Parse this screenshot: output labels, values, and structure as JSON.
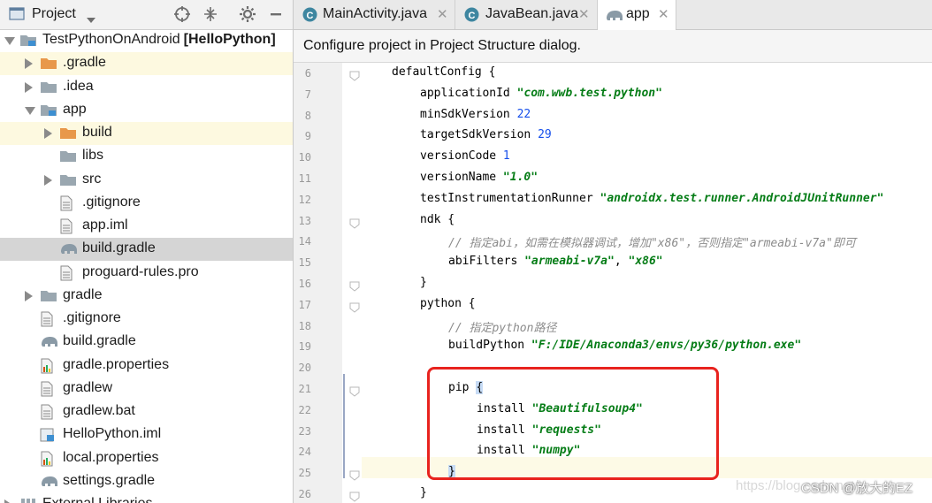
{
  "project_panel": {
    "title": "Project",
    "tree": [
      {
        "label": "TestPythonOnAndroid",
        "suffix": "[HelloPython]",
        "icon": "module-folder-icon",
        "arrow": "down",
        "depth": 0
      },
      {
        "label": ".gradle",
        "icon": "orange-folder-icon",
        "arrow": "right",
        "depth": 1,
        "highlight": true
      },
      {
        "label": ".idea",
        "icon": "folder-icon",
        "arrow": "right",
        "depth": 1
      },
      {
        "label": "app",
        "icon": "module-folder-icon",
        "arrow": "down",
        "depth": 1
      },
      {
        "label": "build",
        "icon": "orange-folder-icon",
        "arrow": "right",
        "depth": 2,
        "highlight": true
      },
      {
        "label": "libs",
        "icon": "folder-icon",
        "arrow": "none",
        "depth": 2
      },
      {
        "label": "src",
        "icon": "folder-icon",
        "arrow": "right",
        "depth": 2
      },
      {
        "label": ".gitignore",
        "icon": "text-file-icon",
        "arrow": "none",
        "depth": 2
      },
      {
        "label": "app.iml",
        "icon": "text-file-icon",
        "arrow": "none",
        "depth": 2
      },
      {
        "label": "build.gradle",
        "icon": "gradle-elephant-icon",
        "arrow": "none",
        "depth": 2,
        "selected": true
      },
      {
        "label": "proguard-rules.pro",
        "icon": "text-file-icon",
        "arrow": "none",
        "depth": 2
      },
      {
        "label": "gradle",
        "icon": "folder-icon",
        "arrow": "right",
        "depth": 1
      },
      {
        "label": ".gitignore",
        "icon": "text-file-icon",
        "arrow": "none",
        "depth": 1
      },
      {
        "label": "build.gradle",
        "icon": "gradle-elephant-icon",
        "arrow": "none",
        "depth": 1
      },
      {
        "label": "gradle.properties",
        "icon": "properties-file-icon",
        "arrow": "none",
        "depth": 1
      },
      {
        "label": "gradlew",
        "icon": "text-file-icon",
        "arrow": "none",
        "depth": 1
      },
      {
        "label": "gradlew.bat",
        "icon": "text-file-icon",
        "arrow": "none",
        "depth": 1
      },
      {
        "label": "HelloPython.iml",
        "icon": "module-file-icon",
        "arrow": "none",
        "depth": 1
      },
      {
        "label": "local.properties",
        "icon": "properties-file-icon",
        "arrow": "none",
        "depth": 1
      },
      {
        "label": "settings.gradle",
        "icon": "gradle-elephant-icon",
        "arrow": "none",
        "depth": 1
      },
      {
        "label": "External Libraries",
        "icon": "library-icon",
        "arrow": "right",
        "depth": 0
      }
    ]
  },
  "tabs": [
    {
      "label": "MainActivity.java",
      "icon": "java-class-icon",
      "active": false
    },
    {
      "label": "JavaBean.java",
      "icon": "java-class-icon",
      "active": false
    },
    {
      "label": "app",
      "icon": "gradle-elephant-icon",
      "active": true
    }
  ],
  "notice": "Configure project in Project Structure dialog.",
  "editor": {
    "lines": [
      {
        "n": "6",
        "indent": 1,
        "parts": [
          [
            "t",
            "defaultConfig {"
          ]
        ]
      },
      {
        "n": "7",
        "indent": 2,
        "parts": [
          [
            "t",
            "applicationId "
          ],
          [
            "s",
            "\"com.wwb.test.python\""
          ]
        ]
      },
      {
        "n": "8",
        "indent": 2,
        "parts": [
          [
            "t",
            "minSdkVersion "
          ],
          [
            "n",
            "22"
          ]
        ]
      },
      {
        "n": "9",
        "indent": 2,
        "parts": [
          [
            "t",
            "targetSdkVersion "
          ],
          [
            "n",
            "29"
          ]
        ]
      },
      {
        "n": "10",
        "indent": 2,
        "parts": [
          [
            "t",
            "versionCode "
          ],
          [
            "n",
            "1"
          ]
        ]
      },
      {
        "n": "11",
        "indent": 2,
        "parts": [
          [
            "t",
            "versionName "
          ],
          [
            "s",
            "\"1.0\""
          ]
        ]
      },
      {
        "n": "12",
        "indent": 2,
        "parts": [
          [
            "t",
            "testInstrumentationRunner "
          ],
          [
            "s",
            "\"androidx.test.runner.AndroidJUnitRunner\""
          ]
        ]
      },
      {
        "n": "13",
        "indent": 2,
        "parts": [
          [
            "t",
            "ndk {"
          ]
        ]
      },
      {
        "n": "14",
        "indent": 3,
        "parts": [
          [
            "c",
            "// 指定abi，如需在模拟器调试，增加\"x86\"，否则指定\"armeabi-v7a\"即可"
          ]
        ]
      },
      {
        "n": "15",
        "indent": 3,
        "parts": [
          [
            "t",
            "abiFilters "
          ],
          [
            "s",
            "\"armeabi-v7a\""
          ],
          [
            "t",
            ", "
          ],
          [
            "s",
            "\"x86\""
          ]
        ]
      },
      {
        "n": "16",
        "indent": 2,
        "parts": [
          [
            "t",
            "}"
          ]
        ]
      },
      {
        "n": "17",
        "indent": 2,
        "parts": [
          [
            "t",
            "python {"
          ]
        ]
      },
      {
        "n": "18",
        "indent": 3,
        "parts": [
          [
            "c",
            "// 指定python路径"
          ]
        ]
      },
      {
        "n": "19",
        "indent": 3,
        "parts": [
          [
            "t",
            "buildPython "
          ],
          [
            "s",
            "\"F:/IDE/Anaconda3/envs/py36/python.exe\""
          ]
        ]
      },
      {
        "n": "20",
        "indent": 0,
        "parts": []
      },
      {
        "n": "21",
        "indent": 3,
        "parts": [
          [
            "t",
            "pip "
          ],
          [
            "b",
            "{"
          ]
        ]
      },
      {
        "n": "22",
        "indent": 4,
        "parts": [
          [
            "t",
            "install "
          ],
          [
            "s",
            "\"Beautifulsoup4\""
          ]
        ]
      },
      {
        "n": "23",
        "indent": 4,
        "parts": [
          [
            "t",
            "install "
          ],
          [
            "s",
            "\"requests\""
          ]
        ]
      },
      {
        "n": "24",
        "indent": 4,
        "parts": [
          [
            "t",
            "install "
          ],
          [
            "s",
            "\"numpy\""
          ]
        ]
      },
      {
        "n": "25",
        "indent": 3,
        "parts": [
          [
            "b",
            "}"
          ]
        ]
      },
      {
        "n": "26",
        "indent": 2,
        "parts": [
          [
            "t",
            "}"
          ]
        ]
      }
    ],
    "fold_markers": [
      "6",
      "13",
      "16",
      "17",
      "21",
      "25",
      "26"
    ]
  },
  "watermark": "https://blog.csdn.net/",
  "watermark_brand": "CSDN @放大的EZ"
}
